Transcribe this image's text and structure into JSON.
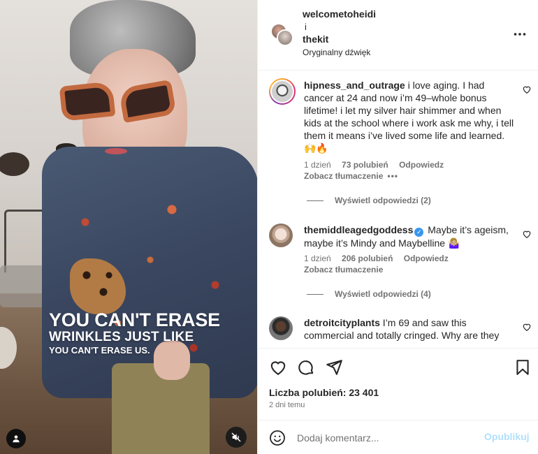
{
  "post": {
    "header": {
      "user1": "welcometoheidi",
      "conjunction": "i",
      "user2": "thekit",
      "audio": "Oryginalny dźwięk",
      "more_icon": "more-horizontal-icon"
    },
    "media": {
      "overlay_line1": "YOU CAN'T ERASE",
      "overlay_line2": "WRINKLES JUST LIKE",
      "overlay_line3": "YOU CAN'T ERASE US.",
      "tag_icon": "user-tag-icon",
      "mute_icon": "audio-muted-icon"
    },
    "comments": [
      {
        "username": "hipness_and_outrage",
        "text": "i love aging. I had cancer at 24 and now i’m 49–whole bonus lifetime! i let my silver hair shimmer and when kids at the school where i work ask me why, i tell them it means i’ve lived some life and learned. 🙌🔥",
        "age": "1 dzień",
        "likes": "73 polubień",
        "reply": "Odpowiedz",
        "translate": "Zobacz tłumaczenie",
        "options": "•••",
        "view_replies": "Wyświetl odpowiedzi (2)"
      },
      {
        "username": "themiddleagedgoddess",
        "verified": "✓",
        "text": "Maybe it’s ageism, maybe it’s Mindy and Maybelline 🤷🏼‍♀️",
        "age": "1 dzień",
        "likes": "206 polubień",
        "reply": "Odpowiedz",
        "translate": "Zobacz tłumaczenie",
        "view_replies": "Wyświetl odpowiedzi (4)"
      },
      {
        "username": "detroitcityplants",
        "text": "I’m 69 and saw this commercial and totally cringed. Why are they"
      }
    ],
    "actions": {
      "like_icon": "heart-icon",
      "comment_icon": "comment-icon",
      "share_icon": "send-icon",
      "save_icon": "bookmark-icon"
    },
    "likes_label": "Liczba polubień: 23 401",
    "posted": "2 dni temu",
    "composer": {
      "placeholder": "Dodaj komentarz...",
      "publish": "Opublikuj",
      "emoji_icon": "emoji-icon"
    }
  },
  "colors": {
    "text": "#262626",
    "secondary": "#737373",
    "verified": "#3897f0",
    "publish_disabled": "#b2dffc",
    "divider": "#efefef"
  }
}
